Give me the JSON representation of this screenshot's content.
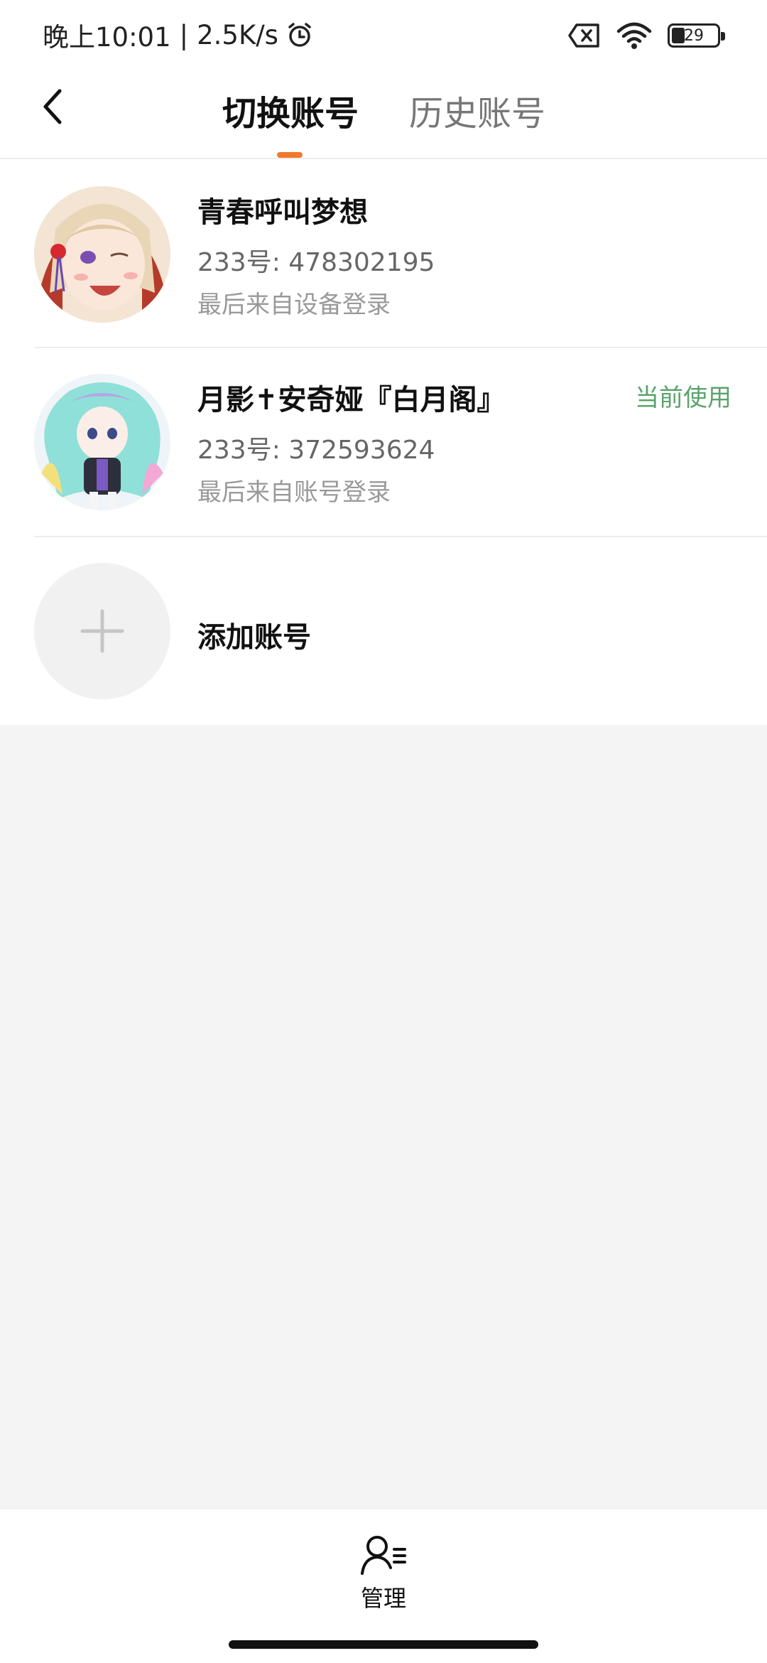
{
  "status_bar": {
    "time": "晚上10:01",
    "separator": "|",
    "net_speed": "2.5K/s",
    "battery_level": "29",
    "icons": [
      "alarm-icon",
      "sim-off-icon",
      "wifi-icon",
      "battery-icon"
    ]
  },
  "header": {
    "tabs": [
      {
        "label": "切换账号",
        "active": true
      },
      {
        "label": "历史账号",
        "active": false
      }
    ],
    "indicator_color": "#f07a2a"
  },
  "accounts": [
    {
      "name": "青春呼叫梦想",
      "uid_text": "233号: 478302195",
      "last_login": "最后来自设备登录",
      "current": false
    },
    {
      "name": "月影✝安奇娅『白月阁』",
      "uid_text": "233号: 372593624",
      "last_login": "最后来自账号登录",
      "current": true,
      "current_label": "当前使用"
    }
  ],
  "add_account": {
    "label": "添加账号"
  },
  "bottom_bar": {
    "manage_label": "管理"
  },
  "colors": {
    "accent": "#f07a2a",
    "current_green": "#5aa36a",
    "page_bg": "#f4f4f4"
  }
}
